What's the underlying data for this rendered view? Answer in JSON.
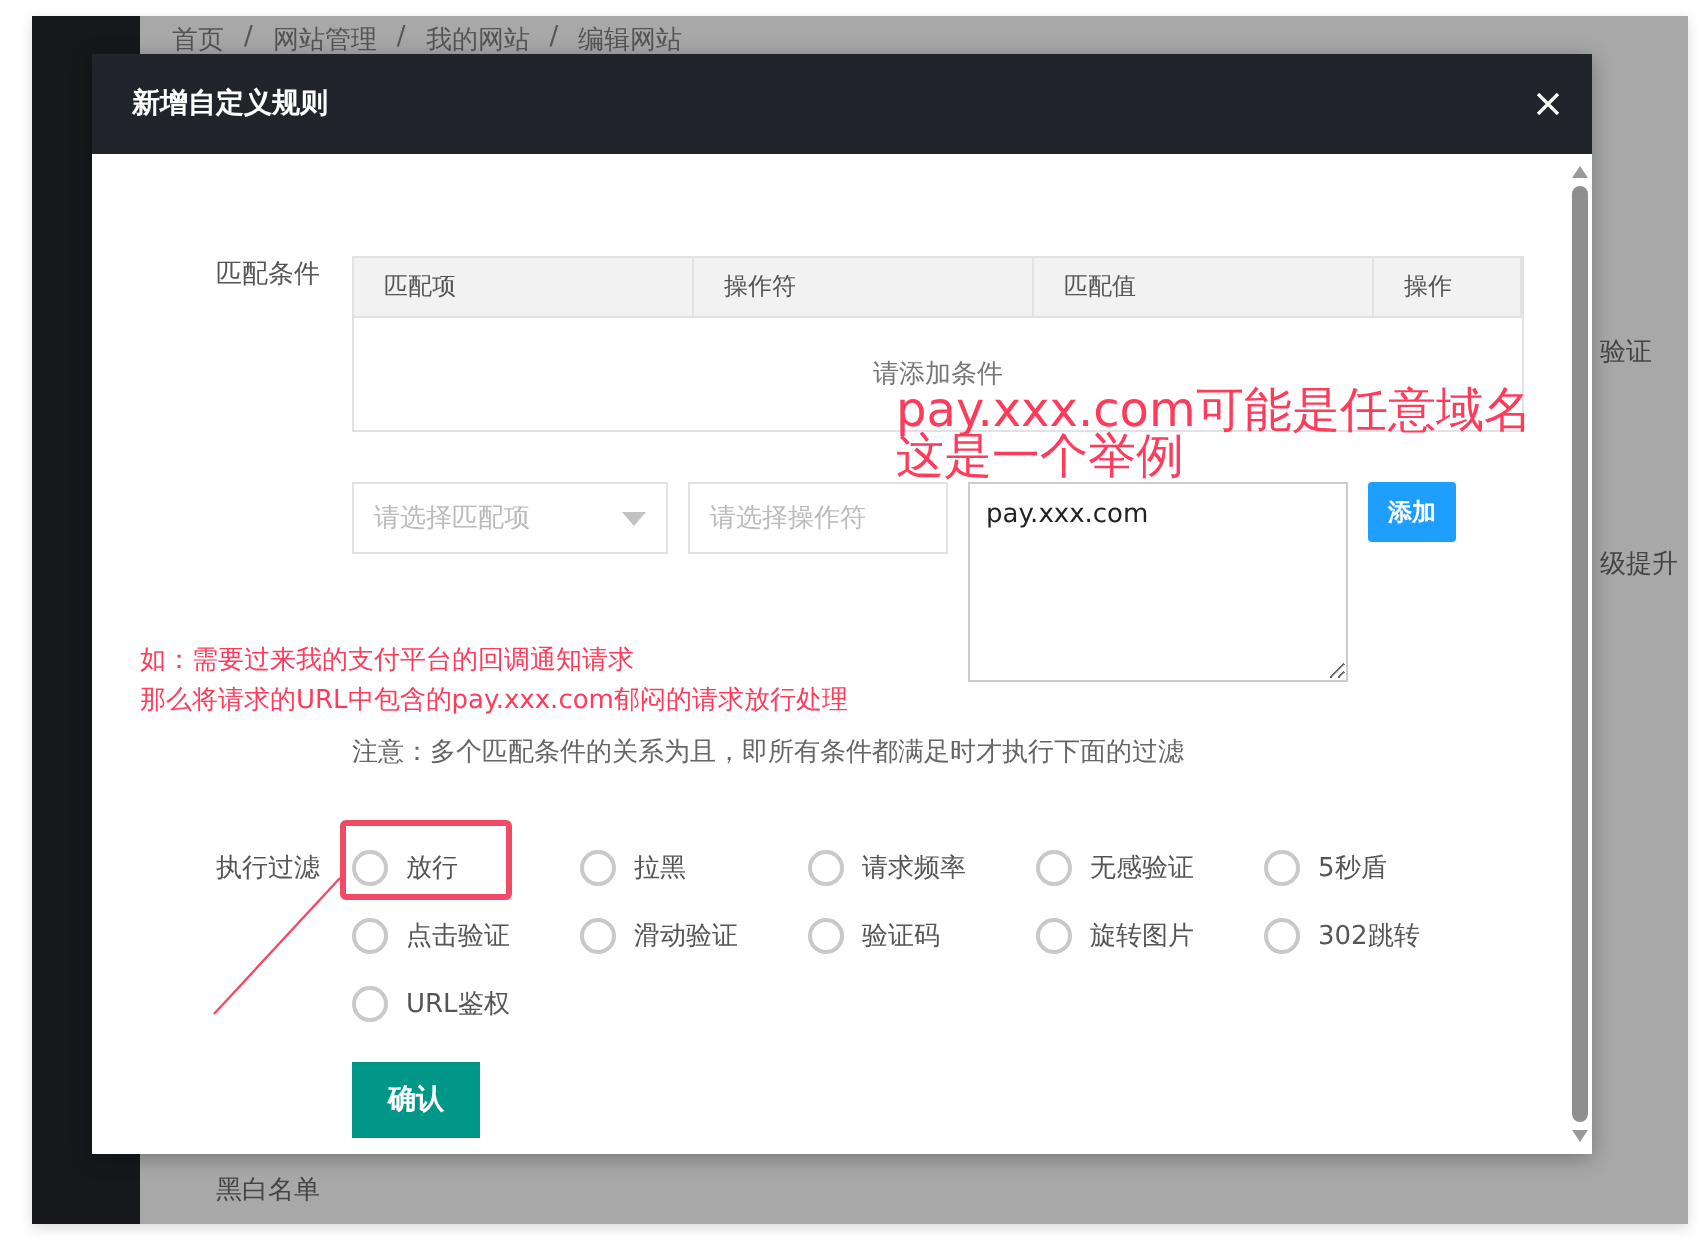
{
  "background": {
    "breadcrumb": [
      "首页",
      "网站管理",
      "我的网站",
      "编辑网站"
    ],
    "separator": "/",
    "side_texts": [
      "验证",
      "级提升",
      "黑白名单"
    ]
  },
  "dialog": {
    "title": "新增自定义规则",
    "conditions": {
      "label": "匹配条件",
      "columns": [
        "匹配项",
        "操作符",
        "匹配值",
        "操作"
      ],
      "empty_text": "请添加条件",
      "match_select": {
        "placeholder": "请选择匹配项"
      },
      "operator_select": {
        "placeholder": "请选择操作符"
      },
      "value_field": {
        "value": "pay.xxx.com"
      },
      "add_button": "添加",
      "note": "注意：多个匹配条件的关系为且，即所有条件都满足时才执行下面的过滤"
    },
    "filter": {
      "label": "执行过滤",
      "options": [
        {
          "label": "放行",
          "selected": false
        },
        {
          "label": "拉黑",
          "selected": false
        },
        {
          "label": "请求频率",
          "selected": false
        },
        {
          "label": "无感验证",
          "selected": false
        },
        {
          "label": "5秒盾",
          "selected": false
        },
        {
          "label": "点击验证",
          "selected": false
        },
        {
          "label": "滑动验证",
          "selected": false
        },
        {
          "label": "验证码",
          "selected": false
        },
        {
          "label": "旋转图片",
          "selected": false
        },
        {
          "label": "302跳转",
          "selected": false
        },
        {
          "label": "URL鉴权",
          "selected": false
        }
      ]
    },
    "confirm_button": "确认"
  },
  "annotations": {
    "domain_note": [
      "pay.xxx.com可能是任意域名",
      "这是一个举例"
    ],
    "example_note": [
      "如：需要过来我的支付平台的回调通知请求",
      "那么将请求的URL中包含的pay.xxx.com郁闷的请求放行处理"
    ]
  }
}
